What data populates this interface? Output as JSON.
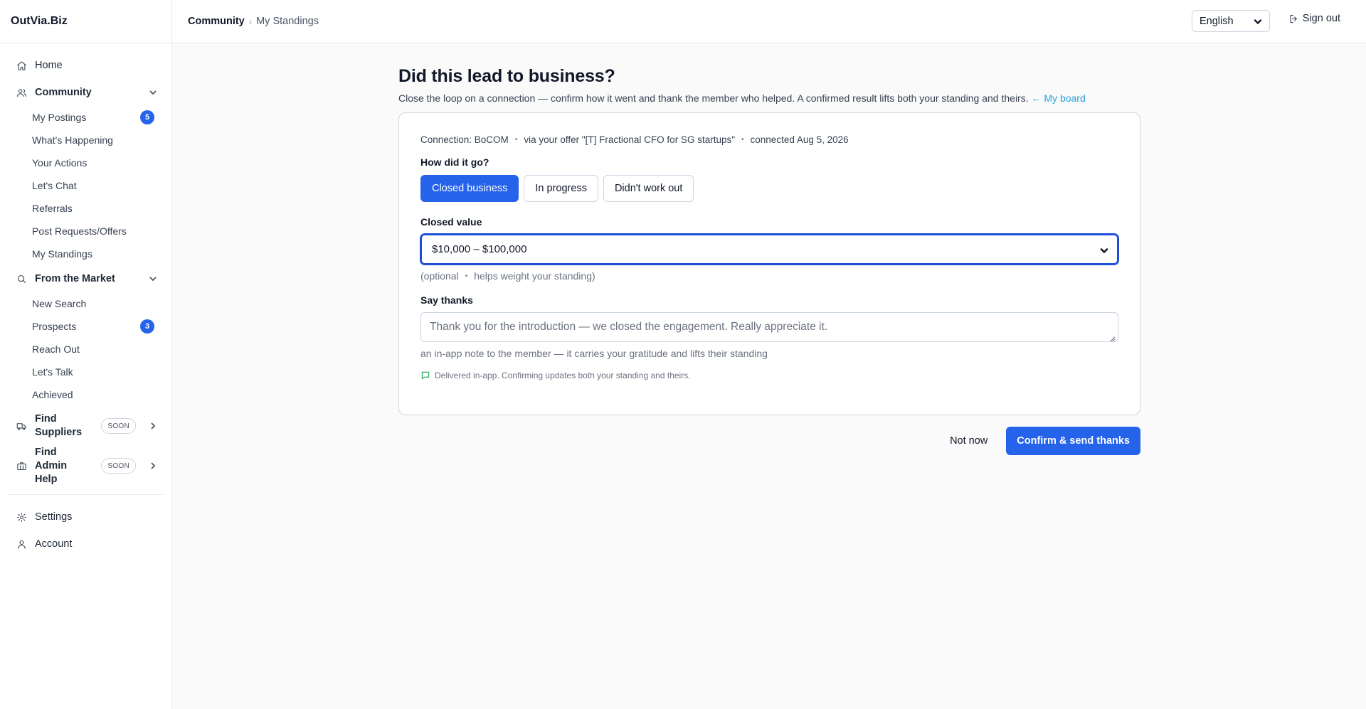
{
  "brand": "OutVia.Biz",
  "sidebar": {
    "home": {
      "label": "Home",
      "icon": "home-icon"
    },
    "community": {
      "label": "Community",
      "icon": "users-icon",
      "items": [
        {
          "label": "My Postings",
          "count": "5"
        },
        {
          "label": "What's Happening"
        },
        {
          "label": "Your Actions"
        },
        {
          "label": "Let's Chat"
        },
        {
          "label": "Referrals"
        },
        {
          "label": "Post Requests/Offers"
        },
        {
          "label": "My Standings"
        }
      ]
    },
    "market": {
      "label": "From the Market",
      "icon": "search-icon",
      "items": [
        {
          "label": "New Search"
        },
        {
          "label": "Prospects",
          "count": "3"
        },
        {
          "label": "Reach Out"
        },
        {
          "label": "Let's Talk"
        },
        {
          "label": "Achieved"
        }
      ]
    },
    "suppliers": {
      "label": "Find Suppliers",
      "badge": "SOON",
      "icon": "truck-icon"
    },
    "admin_help": {
      "label": "Find Admin Help",
      "badge": "SOON",
      "icon": "briefcase-icon"
    },
    "settings": {
      "label": "Settings",
      "icon": "gear-icon"
    },
    "account": {
      "label": "Account",
      "icon": "user-icon"
    }
  },
  "header": {
    "breadcrumb": {
      "parent": "Community",
      "separator": "›",
      "current": "My Standings"
    },
    "language": "English",
    "sign_out": "Sign out"
  },
  "main": {
    "title": "Did this lead to business?",
    "description": "Close the loop on a connection — confirm how it went and thank the member who helped. A confirmed result lifts both your standing and theirs.",
    "board_link": "← My board",
    "card": {
      "connection": "Connection: BoCOM",
      "offer": "via your offer \"[T] Fractional CFO for SG startups\"",
      "connected": "connected Aug 5, 2026",
      "separator": "•",
      "question": "How did it go?",
      "choices": [
        "Closed business",
        "In progress",
        "Didn't work out"
      ],
      "selected_choice": "Closed business",
      "closed_value_label": "Closed value",
      "closed_value": "$10,000 – $100,000",
      "hint_optional": "(optional",
      "hint_weight": "helps weight your standing)",
      "thanks_label": "Say thanks",
      "thanks_placeholder": "Thank you for the introduction — we closed the engagement. Really appreciate it.",
      "thanks_note": "an in-app note to the member — it carries your gratitude and lifts their standing",
      "delivered": "Delivered in-app. Confirming updates both your standing and theirs."
    },
    "actions": {
      "not_now": "Not now",
      "confirm": "Confirm & send thanks"
    }
  },
  "colors": {
    "accent": "#2563eb",
    "link": "#2a9fd6",
    "success": "#16a34a"
  }
}
